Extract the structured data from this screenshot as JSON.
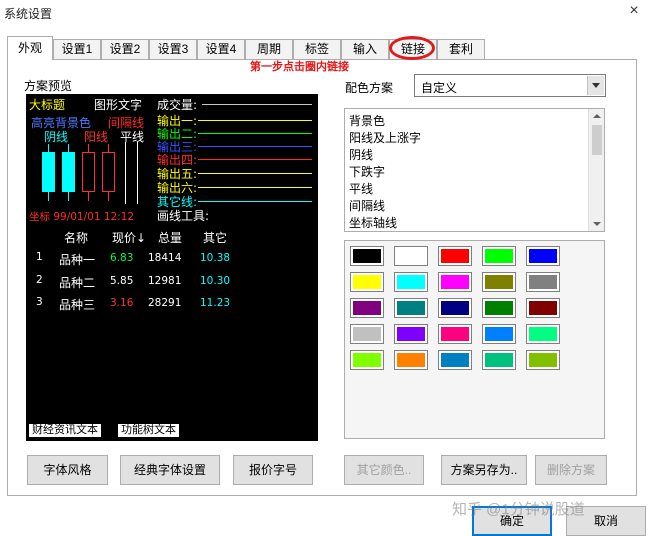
{
  "window": {
    "title": "系统设置",
    "close_glyph": "×"
  },
  "tabs": [
    {
      "label": "外观",
      "active": true
    },
    {
      "label": "设置1"
    },
    {
      "label": "设置2"
    },
    {
      "label": "设置3"
    },
    {
      "label": "设置4"
    },
    {
      "label": "周期"
    },
    {
      "label": "标签"
    },
    {
      "label": "输入"
    },
    {
      "label": "链接"
    },
    {
      "label": "套利"
    }
  ],
  "annotation": {
    "hint": "第一步点击圈内链接",
    "color": "#e21b1b"
  },
  "preview": {
    "label": "方案预览",
    "big_title": "大标题",
    "graph_text": "图形文字",
    "highlight_bg": "高亮背景色",
    "grid_line": "间隔线",
    "yin": "阴线",
    "yang": "阳线",
    "flat": "平线",
    "volume": "成交量:",
    "outputs": [
      "输出一:",
      "输出二:",
      "输出三:",
      "输出四:",
      "输出五:",
      "输出六:"
    ],
    "other_line": "其它线:",
    "draw_tool": "画线工具:",
    "coord": "坐标 99/01/01 12:12",
    "table": {
      "headers": [
        "名称",
        "现价↓",
        "总量",
        "其它"
      ],
      "rows": [
        {
          "no": "1",
          "name": "品种一",
          "price": "6.83",
          "volume": "18414",
          "other": "10.38"
        },
        {
          "no": "2",
          "name": "品种二",
          "price": "5.85",
          "volume": "12981",
          "other": "10.30"
        },
        {
          "no": "3",
          "name": "品种三",
          "price": "3.16",
          "volume": "28291",
          "other": "11.23"
        }
      ]
    },
    "chips": [
      "财经资讯文本",
      "功能树文本"
    ],
    "colors": {
      "bg": "#000000",
      "title": "#ffff00",
      "highlight": "#4d7bff",
      "grid": "#ff2a2a",
      "yin": "#00ffff",
      "yang": "#ff3030",
      "up_price": "#00ff40",
      "down_price": "#ff3030",
      "other": "#00ffff",
      "out1": "#ffff00",
      "out2": "#00ff00",
      "out3": "#3355ff",
      "out4": "#ff2a2a",
      "out5": "#ffff00",
      "out6": "#ffff00",
      "coord": "#ff2a2a"
    }
  },
  "scheme": {
    "label": "配色方案",
    "value": "自定义"
  },
  "items": [
    "背景色",
    "阳线及上涨字",
    "阴线",
    "下跌字",
    "平线",
    "间隔线",
    "坐标轴线"
  ],
  "palette": [
    "#000000",
    "#ffffff",
    "#ff0000",
    "#00ff00",
    "#0000ff",
    "#ffff00",
    "#00ffff",
    "#ff00ff",
    "#808000",
    "#808080",
    "#800080",
    "#008080",
    "#000080",
    "#008000",
    "#800000",
    "#c0c0c0",
    "#8000ff",
    "#ff0080",
    "#0080ff",
    "#00ff80",
    "#80ff00",
    "#ff8000",
    "#0080c0",
    "#00c080",
    "#80c000"
  ],
  "buttons": {
    "font_style": "字体风格",
    "classic_font": "经典字体设置",
    "quote_font": "报价字号",
    "other_color": "其它颜色..",
    "save_as": "方案另存为..",
    "delete": "删除方案",
    "ok": "确定",
    "cancel": "取消"
  },
  "watermark": "知乎 @1分钟说股道"
}
